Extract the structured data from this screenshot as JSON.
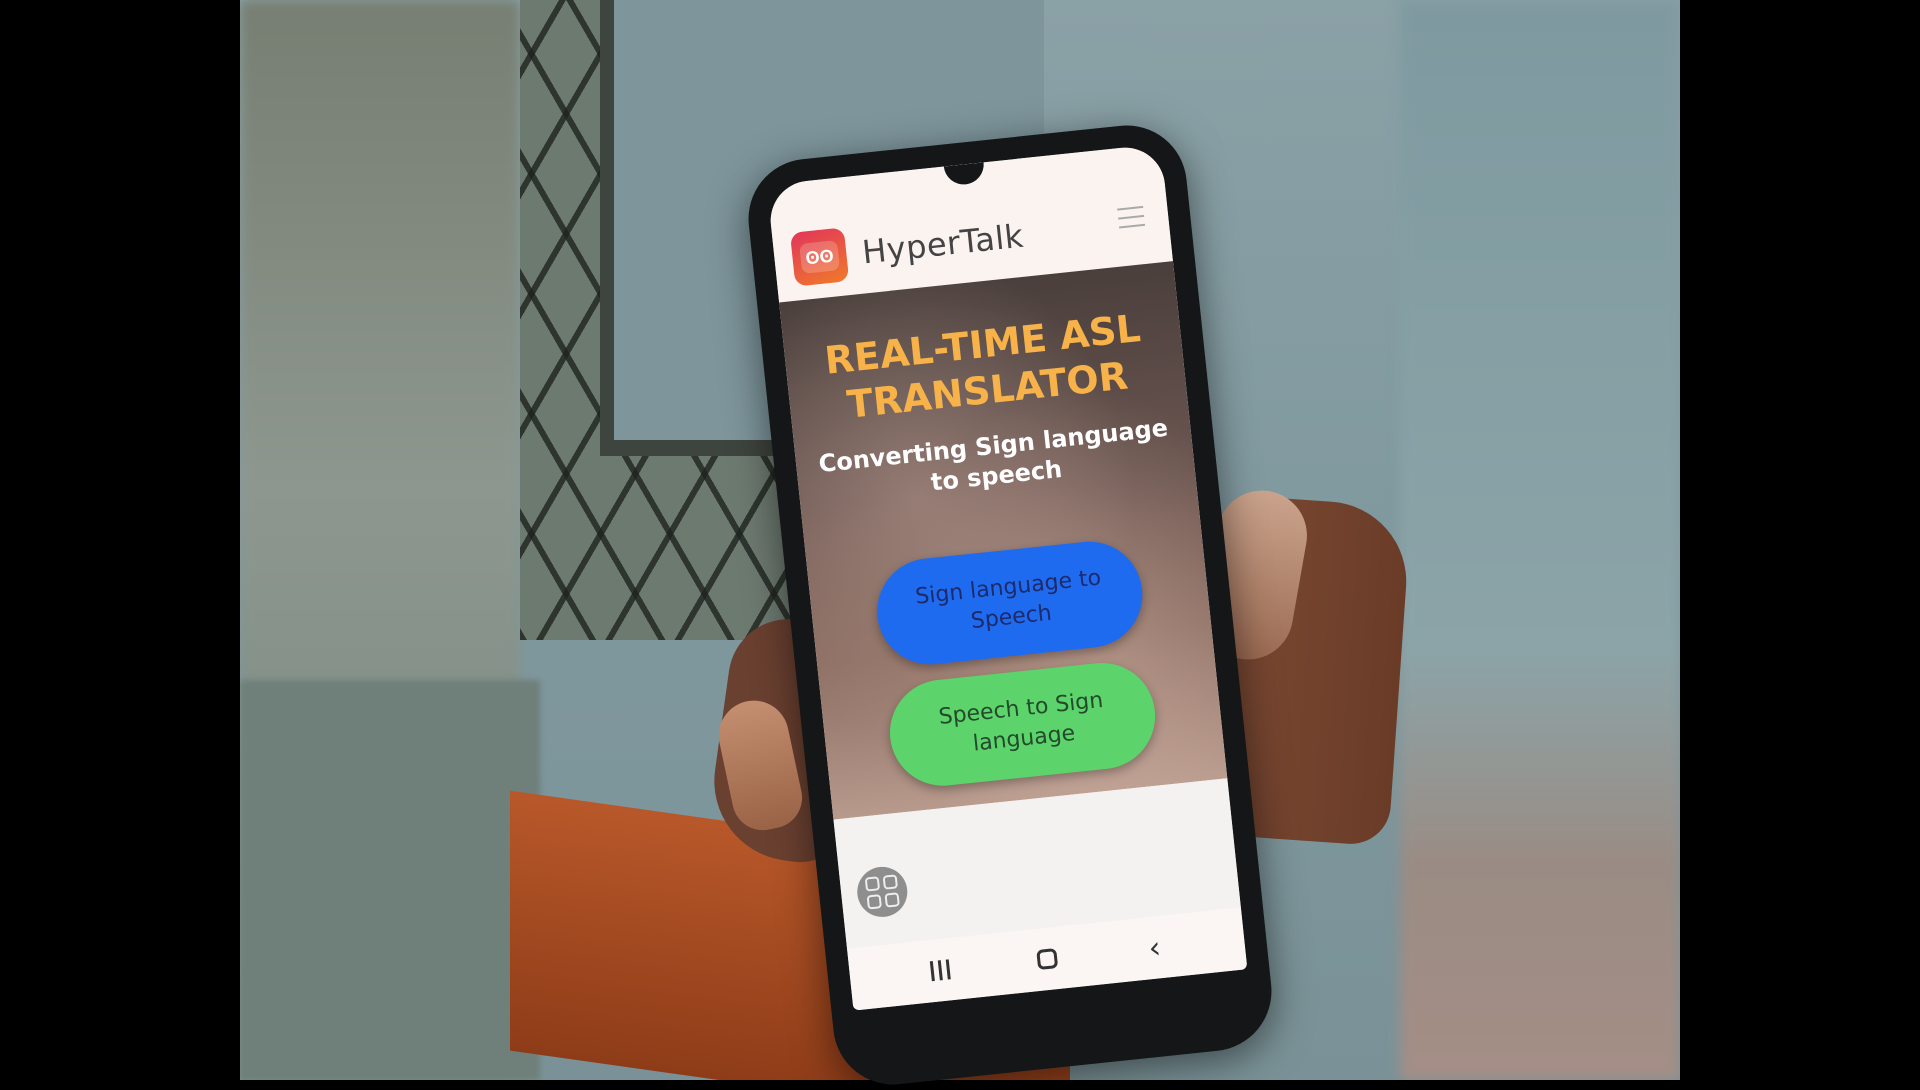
{
  "app": {
    "title": "HyperTalk",
    "logo_text": "ʘʘ"
  },
  "hero": {
    "title": "REAL-TIME ASL TRANSLATOR",
    "subtitle": "Converting Sign language to speech"
  },
  "buttons": {
    "sign_to_speech": "Sign language to Speech",
    "speech_to_sign": "Speech to Sign language"
  },
  "icons": {
    "menu": "hamburger-menu-icon",
    "floating": "grid-icon",
    "nav_recents": "recents-icon",
    "nav_home": "home-icon",
    "nav_back": "back-icon"
  },
  "nav": {
    "back_glyph": "‹"
  },
  "colors": {
    "accent_title": "#f7b24a",
    "button_blue": "#1f6bf0",
    "button_green": "#5cd36b"
  }
}
